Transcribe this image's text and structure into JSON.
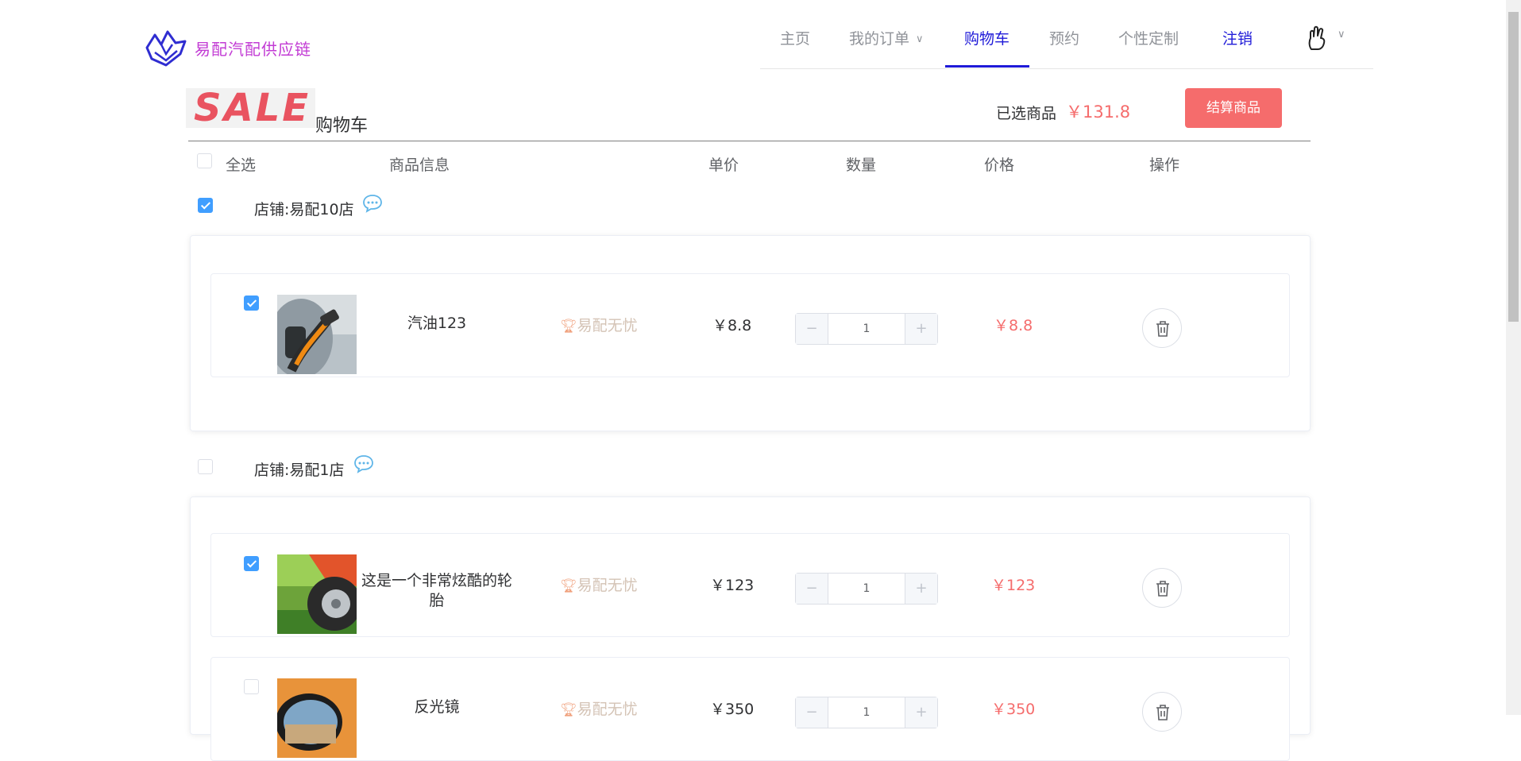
{
  "header": {
    "brand": "易配汽配供应链",
    "nav": [
      {
        "label": "主页"
      },
      {
        "label": "我的订单"
      },
      {
        "label": "购物车"
      },
      {
        "label": "预约"
      },
      {
        "label": "个性定制"
      },
      {
        "label": "注销"
      }
    ],
    "active_nav": "购物车"
  },
  "titlebar": {
    "sale_text": "SALE",
    "title": "购物车",
    "selected_label": "已选商品",
    "selected_amount": "￥131.8",
    "checkout_label": "结算商品"
  },
  "columns": {
    "select_all": "全选",
    "info": "商品信息",
    "unit_price": "单价",
    "quantity": "数量",
    "price": "价格",
    "action": "操作"
  },
  "shops": [
    {
      "name": "店铺:易配10店",
      "checked": true,
      "items": [
        {
          "name": "汽油123",
          "badge": "易配无忧",
          "unit_price": "￥8.8",
          "qty": "1",
          "total": "￥8.8",
          "checked": true
        }
      ]
    },
    {
      "name": "店铺:易配1店",
      "checked": false,
      "items": [
        {
          "name": "这是一个非常炫酷的轮胎",
          "badge": "易配无忧",
          "unit_price": "￥123",
          "qty": "1",
          "total": "￥123",
          "checked": true
        },
        {
          "name": "反光镜",
          "badge": "易配无忧",
          "unit_price": "￥350",
          "qty": "1",
          "total": "￥350",
          "checked": false
        }
      ]
    }
  ],
  "colors": {
    "accent": "#1f1ad8",
    "price": "#f56c6c",
    "checkbox": "#409eff",
    "checkout": "#f56c6c"
  },
  "icons": {
    "logo": "fox-logo-icon",
    "chat": "chat-bubble-icon",
    "delete": "trash-icon",
    "avatar": "hand-gesture-icon"
  }
}
